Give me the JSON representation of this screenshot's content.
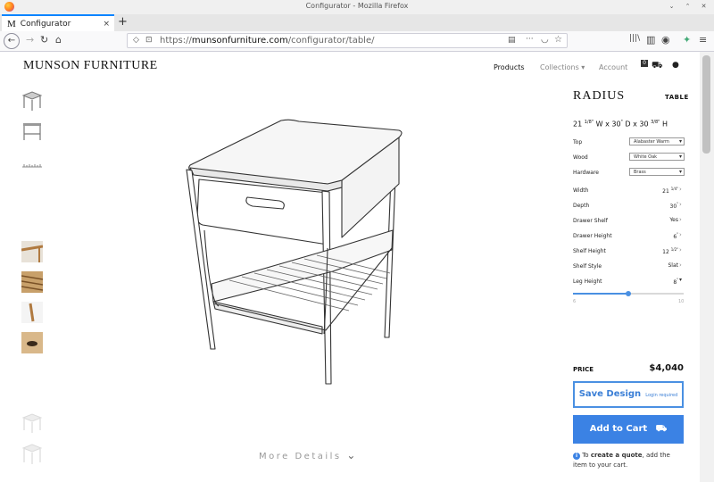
{
  "window": {
    "title": "Configurator - Mozilla Firefox",
    "controls": [
      "⌄",
      "⌃",
      "✕"
    ]
  },
  "tab": {
    "favicon": "M",
    "title": "Configurator",
    "close": "×",
    "new_tab": "+"
  },
  "nav": {
    "back": "←",
    "forward": "→",
    "reload": "↻",
    "home": "⌂",
    "url_prefix": "https://",
    "url_host": "munsonfurniture.com",
    "url_path": "/configurator/table/",
    "reader": "▤",
    "more": "···",
    "pocket": "◡",
    "bookmark": "☆",
    "library": "|||\\",
    "sidebar": "▥",
    "account": "◉",
    "addons": "✦",
    "menu": "≡"
  },
  "site": {
    "logo": "MUNSON FURNITURE",
    "nav": {
      "products": "Products",
      "collections": "Collections",
      "collections_caret": "▾",
      "account": "Account",
      "cart_count": "0",
      "truck_icon": "⛟",
      "user_icon": "●"
    }
  },
  "product": {
    "name": "RADIUS",
    "category": "TABLE",
    "dims": {
      "w": "21",
      "w_frac": "1/8\"",
      "w_rest": " W x 30",
      "d_frac": "\"",
      "d_rest": " D x 30",
      "h_frac": "3/8\"",
      "h_rest": " H"
    },
    "options": [
      {
        "label": "Top",
        "value": "Alabaster Warm"
      },
      {
        "label": "Wood",
        "value": "White Oak"
      },
      {
        "label": "Hardware",
        "value": "Brass"
      }
    ],
    "rows": [
      {
        "label": "Width",
        "value": "21",
        "frac": "1/4\""
      },
      {
        "label": "Depth",
        "value": "30",
        "frac": "\""
      },
      {
        "label": "Drawer Shelf",
        "value": "Yes",
        "frac": ""
      },
      {
        "label": "Drawer Height",
        "value": "6",
        "frac": "\""
      },
      {
        "label": "Shelf Height",
        "value": "12",
        "frac": "1/2\""
      },
      {
        "label": "Shelf Style",
        "value": "Slat",
        "frac": ""
      },
      {
        "label": "Leg Height",
        "value": "8",
        "frac": "\""
      }
    ],
    "slider": {
      "min": "6",
      "max": "10",
      "value_fraction": 0.5
    },
    "price_label": "PRICE",
    "price": "$4,040",
    "save_label": "Save Design",
    "save_sub": "Login required",
    "cart_label": "Add to Cart",
    "cart_icon": "⛟",
    "quote_pre": " To ",
    "quote_link": "create a quote",
    "quote_post": ", add the item to your cart.",
    "info_icon": "i"
  },
  "viewer": {
    "more_details": "More Details",
    "more_icon": "⌄"
  }
}
